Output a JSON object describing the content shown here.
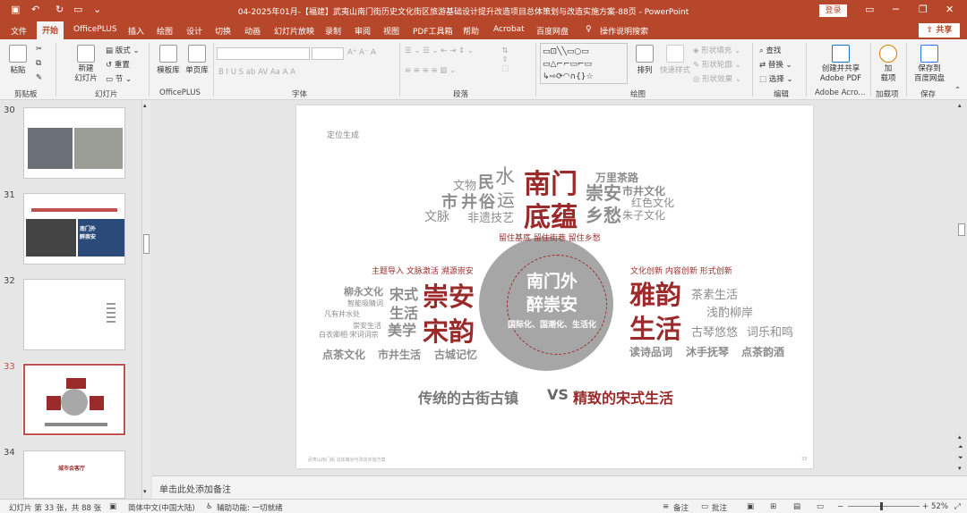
{
  "titlebar": {
    "title": "04-2025年01月-【福建】武夷山南门街历史文化街区旅游基础设计提升改造项目总体策划与改造实施方案-88页 - PowerPoint",
    "login": "登录"
  },
  "tabs": [
    "文件",
    "开始",
    "OfficePLUS",
    "插入",
    "绘图",
    "设计",
    "切换",
    "动画",
    "幻灯片放映",
    "录制",
    "审阅",
    "视图",
    "PDF工具箱",
    "帮助",
    "Acrobat",
    "百度网盘",
    "操作说明搜索"
  ],
  "share": "共享",
  "ribbon": {
    "clipboard": {
      "paste": "粘贴",
      "label": "剪贴板"
    },
    "slides": {
      "new_slide": "新建\n幻灯片",
      "layout": "版式",
      "reset": "重置",
      "section": "节",
      "label": "幻灯片"
    },
    "officeplus": {
      "template": "模板库",
      "single": "单页库",
      "label": "OfficePLUS"
    },
    "font": {
      "label": "字体"
    },
    "paragraph": {
      "label": "段落"
    },
    "drawing": {
      "arrange": "排列",
      "quick_styles": "快速样式",
      "fill": "形状填充",
      "outline": "形状轮廓",
      "effect": "形状效果",
      "label": "绘图"
    },
    "editing": {
      "find": "查找",
      "replace": "替换",
      "select": "选择",
      "label": "编辑"
    },
    "adobe": {
      "create": "创建并共享\nAdobe PDF",
      "label": "Adobe Acro..."
    },
    "addins": {
      "add": "加\n载项",
      "label": "加载项"
    },
    "save": {
      "save_baidu": "保存到\n百度网盘",
      "label": "保存"
    }
  },
  "thumbnails": [
    {
      "num": "30",
      "current": false
    },
    {
      "num": "31",
      "current": false,
      "title": "南门外 醉崇安"
    },
    {
      "num": "32",
      "current": false
    },
    {
      "num": "33",
      "current": true
    },
    {
      "num": "34",
      "current": false,
      "title": "城市会客厅"
    }
  ],
  "slide": {
    "header": "定位生成",
    "footer": "武夷山南门街 总体策划与改造实施方案",
    "page": "33",
    "center_title1": "南门外",
    "center_title2": "醉崇安",
    "center_sub": "国际化、国潮化、生活化",
    "ring_text": "留住基底 留住街巷 留住乡愁",
    "left_tag": "主题导入 文脉激活 溯源崇安",
    "right_tag": "文化创新 内容创新 形式创新",
    "top_words": {
      "w1": "文物",
      "w2": "民",
      "w3": "水",
      "w4": "市",
      "w5": "井",
      "w6": "俗",
      "w7": "运",
      "w8": "文脉",
      "w9": "非遗技艺",
      "w10": "南门",
      "w11": "底蕴",
      "w12": "万里茶路",
      "w13": "崇安",
      "w14": "市井文化",
      "w15": "红色文化",
      "w16": "乡愁",
      "w17": "朱子文化"
    },
    "left_words": {
      "w1": "柳永文化",
      "w2": "宋式",
      "w3": "崇安",
      "w4": "智能吸睛词",
      "w5": "生活",
      "w6": "凡有井水处",
      "w7": "崇安生活",
      "w8": "美学",
      "w9": "宋韵",
      "w10": "白衣卿相·宋词词宗",
      "w11": "点茶文化",
      "w12": "市井生活",
      "w13": "古城记忆"
    },
    "right_words": {
      "w1": "雅韵",
      "w2": "茶素生活",
      "w3": "浅酌柳岸",
      "w4": "生活",
      "w5": "古琴悠悠",
      "w6": "词乐和鸣",
      "w7": "读诗品词",
      "w8": "沐手抚琴",
      "w9": "点茶韵酒"
    },
    "bottom_gray": "传统的古街古镇",
    "bottom_vs": "VS",
    "bottom_red": "精致的宋式生活"
  },
  "notes_placeholder": "单击此处添加备注",
  "status": {
    "slide_info": "幻灯片 第 33 张，共 88 张",
    "language": "简体中文(中国大陆)",
    "accessibility": "辅助功能: 一切就绪",
    "notes": "备注",
    "comments": "批注",
    "zoom": "52%"
  },
  "colors": {
    "accent": "#b7472a",
    "red_word": "#9b2b2b",
    "gray_word": "#8d8d8d"
  }
}
